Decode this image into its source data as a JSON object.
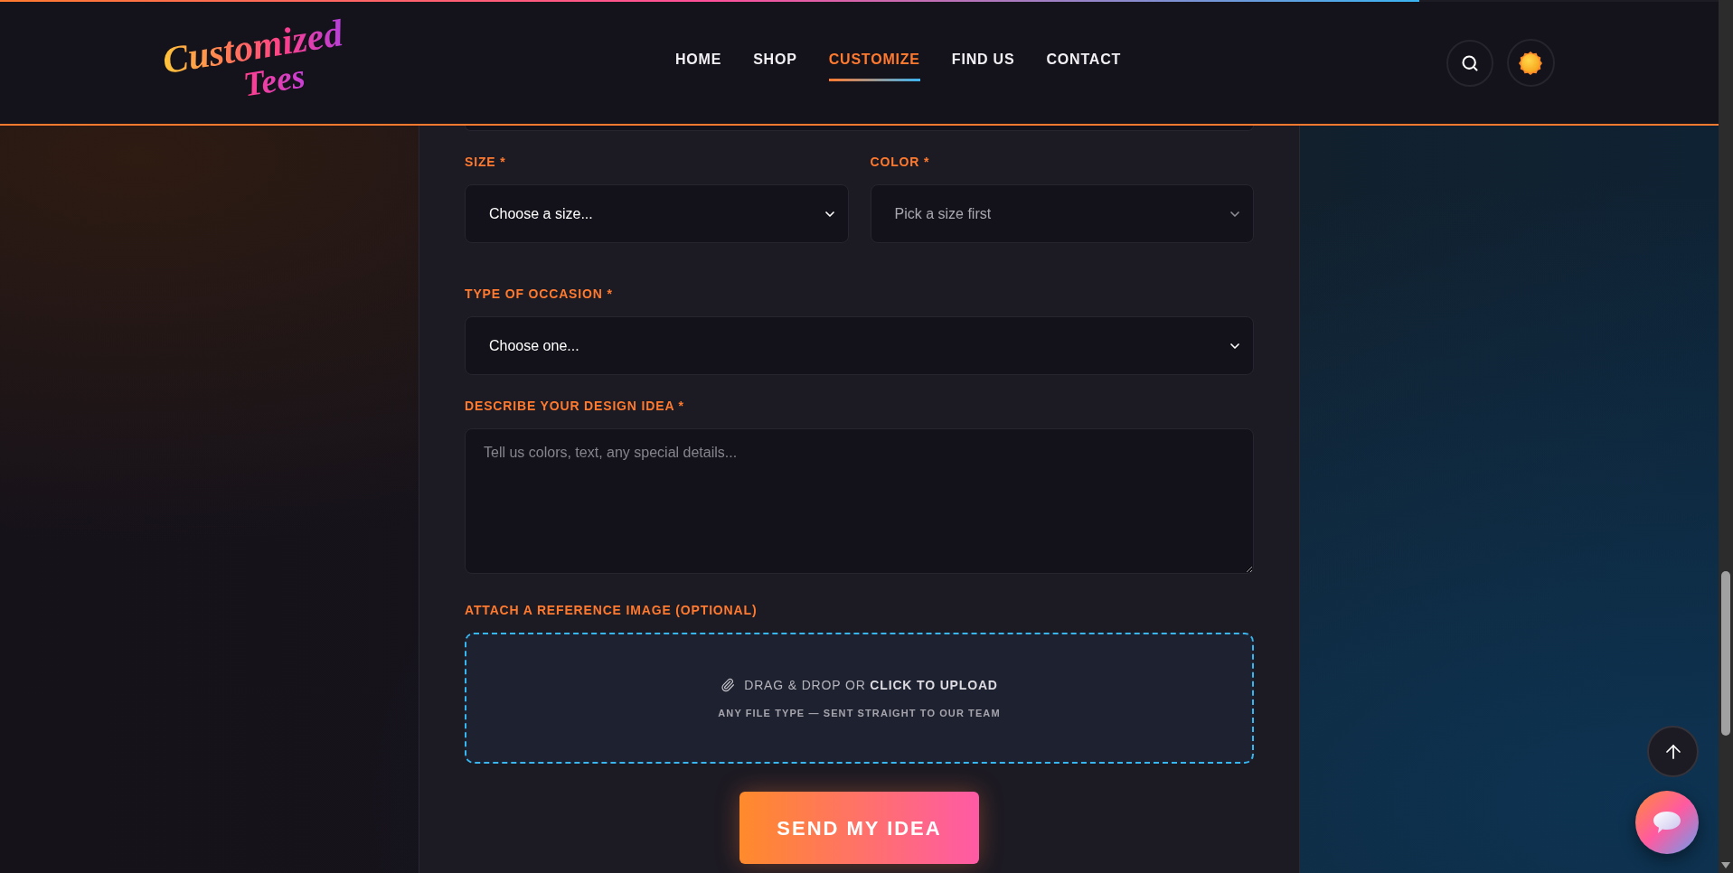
{
  "scroll_progress": {
    "level": 0.826
  },
  "header": {
    "logo": [
      "Customized",
      "Tees"
    ],
    "nav": [
      {
        "label": "HOME",
        "selected": false
      },
      {
        "label": "SHOP",
        "selected": false
      },
      {
        "label": "CUSTOMIZE",
        "selected": true
      },
      {
        "label": "FIND US",
        "selected": false
      },
      {
        "label": "CONTACT",
        "selected": false
      }
    ]
  },
  "rows": [
    [
      {
        "kind": "select",
        "label": "SIZE *",
        "value": "Choose a size...",
        "disabled": false
      },
      {
        "kind": "select",
        "label": "COLOR *",
        "value": "Pick a size first",
        "disabled": true
      }
    ],
    [
      {
        "kind": "select",
        "label": "TYPE OF OCCASION *",
        "value": "Choose one...",
        "disabled": false
      }
    ],
    [
      {
        "kind": "textarea",
        "label": "DESCRIBE YOUR DESIGN IDEA *",
        "placeholder": "Tell us colors, text, any special details..."
      }
    ],
    [
      {
        "kind": "upload",
        "label": "ATTACH A REFERENCE IMAGE (OPTIONAL)",
        "prompt": "DRAG & DROP OR **CLICK TO UPLOAD**",
        "hint": "ANY FILE TYPE — SENT STRAIGHT TO OUR TEAM"
      }
    ]
  ],
  "submit": "SEND MY IDEA"
}
